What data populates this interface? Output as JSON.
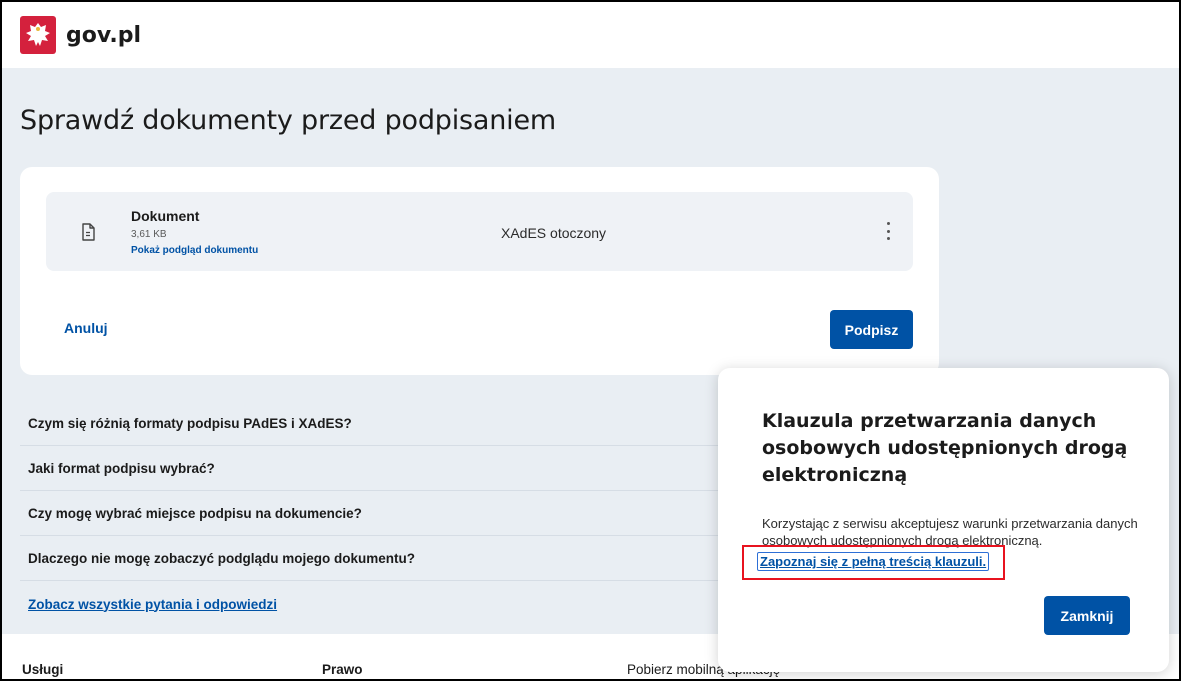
{
  "header": {
    "brand": "gov.pl"
  },
  "page": {
    "title": "Sprawdź dokumenty przed podpisaniem"
  },
  "document": {
    "name": "Dokument",
    "size": "3,61 KB",
    "preview_link": "Pokaż podgląd dokumentu",
    "format": "XAdES otoczony"
  },
  "actions": {
    "cancel_label": "Anuluj",
    "sign_label": "Podpisz"
  },
  "faq": {
    "items": [
      "Czym się różnią formaty podpisu PAdES i XAdES?",
      "Jaki format podpisu wybrać?",
      "Czy mogę wybrać miejsce podpisu na dokumencie?",
      "Dlaczego nie mogę zobaczyć podglądu mojego dokumentu?"
    ],
    "all_link": "Zobacz wszystkie pytania i odpowiedzi"
  },
  "footer": {
    "col1": "Usługi",
    "col2": "Prawo",
    "col3": "Pobierz mobilną aplikację"
  },
  "modal": {
    "title": "Klauzula przetwarzania danych osobowych udostępnionych drogą elektroniczną",
    "text": "Korzystając z serwisu akceptujesz warunki przetwarzania danych osobowych udostępnionych drogą elektroniczną.",
    "link": "Zapoznaj się z pełną treścią klauzuli.",
    "close_label": "Zamknij"
  },
  "colors": {
    "primary": "#0052a5",
    "background": "#e9eef3",
    "highlight": "#e8131f",
    "emblem": "#d4213d"
  },
  "icons": {
    "logo": "polish-eagle-icon",
    "document": "document-icon",
    "menu": "kebab-menu-icon"
  }
}
